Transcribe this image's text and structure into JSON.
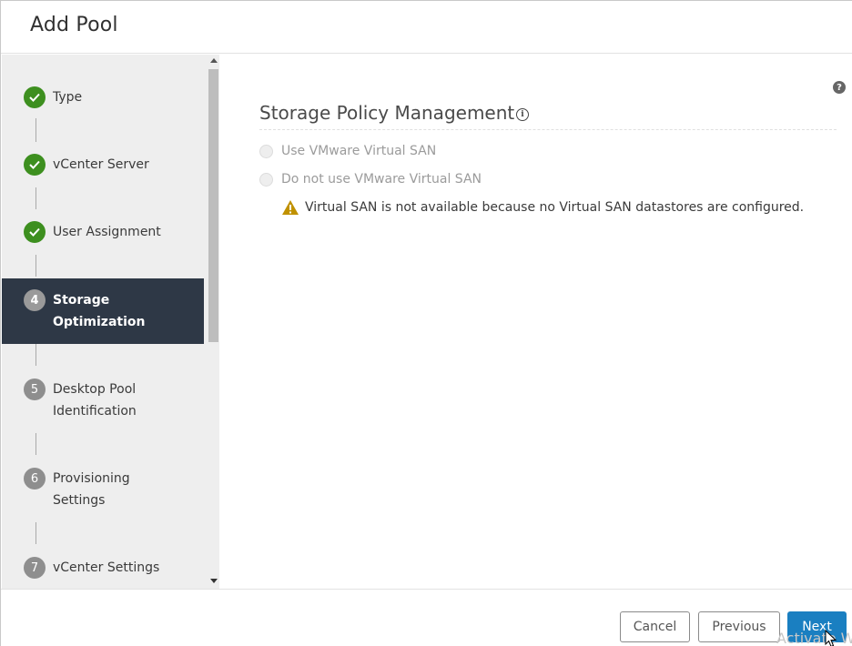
{
  "dialog": {
    "title": "Add Pool"
  },
  "steps": [
    {
      "number": "1",
      "label": "Type",
      "status": "done"
    },
    {
      "number": "2",
      "label": "vCenter Server",
      "status": "done"
    },
    {
      "number": "3",
      "label": "User Assignment",
      "status": "done"
    },
    {
      "number": "4",
      "label_line1": "Storage",
      "label_line2": "Optimization",
      "status": "active"
    },
    {
      "number": "5",
      "label_line1": "Desktop Pool",
      "label_line2": "Identification",
      "status": "pending"
    },
    {
      "number": "6",
      "label_line1": "Provisioning",
      "label_line2": "Settings",
      "status": "pending"
    },
    {
      "number": "7",
      "label": "vCenter Settings",
      "status": "pending"
    }
  ],
  "main": {
    "help_icon": "question-icon",
    "section_title": "Storage Policy Management",
    "info_icon": "info-icon",
    "options": [
      {
        "label": "Use VMware Virtual SAN",
        "selected": false,
        "disabled": true
      },
      {
        "label": "Do not use VMware Virtual SAN",
        "selected": false,
        "disabled": true
      }
    ],
    "warning": "Virtual SAN is not available because no Virtual SAN datastores are configured."
  },
  "footer": {
    "cancel": "Cancel",
    "previous": "Previous",
    "next": "Next",
    "watermark": "Activate W"
  },
  "colors": {
    "done": "#3d8f1f",
    "active_bg": "#2e3846",
    "primary": "#1a7fc1",
    "warning": "#c09100"
  }
}
